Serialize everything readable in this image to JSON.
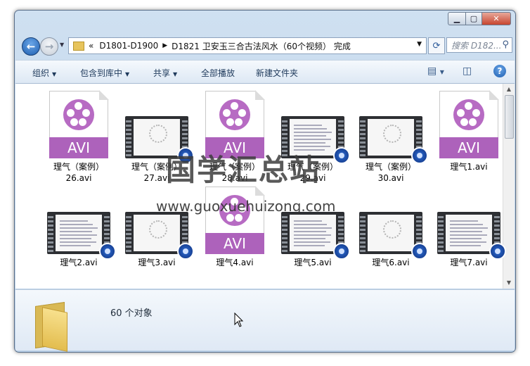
{
  "window": {
    "min": "▁",
    "max": "▢",
    "close": "✕"
  },
  "nav": {
    "back_icon": "back-arrow",
    "fwd_icon": "forward-arrow",
    "address": {
      "prefix": "«",
      "crumb1": "D1801-D1900",
      "crumb2": "D1821 卫安玉三合古法风水（60个视频） 完成"
    },
    "search_placeholder": "搜索 D182..."
  },
  "toolbar": {
    "organize": "组织",
    "include": "包含到库中",
    "share": "共享",
    "playall": "全部播放",
    "newfolder": "新建文件夹"
  },
  "files": [
    {
      "label": "理气（案例）26.avi",
      "type": "avi"
    },
    {
      "label": "理气（案例）27.avi",
      "type": "thumb"
    },
    {
      "label": "理气（案例）28.avi",
      "type": "avi"
    },
    {
      "label": "理气（案例）29.avi",
      "type": "thumb"
    },
    {
      "label": "理气（案例）30.avi",
      "type": "thumb"
    },
    {
      "label": "理气1.avi",
      "type": "avi"
    },
    {
      "label": "理气2.avi",
      "type": "thumb"
    },
    {
      "label": "理气3.avi",
      "type": "thumb"
    },
    {
      "label": "理气4.avi",
      "type": "avi"
    },
    {
      "label": "理气5.avi",
      "type": "thumb"
    },
    {
      "label": "理气6.avi",
      "type": "thumb"
    },
    {
      "label": "理气7.avi",
      "type": "thumb"
    }
  ],
  "avi_text": "AVI",
  "status": {
    "count": "60 个对象"
  },
  "watermark": {
    "title": "国学汇总站",
    "url": "www.guoxuehuizong.com"
  }
}
